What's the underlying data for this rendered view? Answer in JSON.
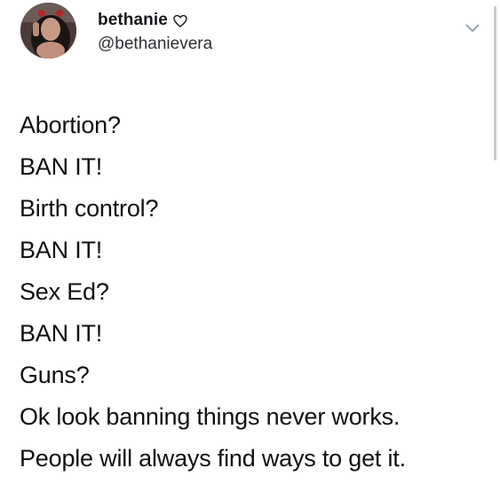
{
  "user": {
    "display_name": "bethanie",
    "handle": "@bethanievera",
    "badge_icon": "heart-outline-icon",
    "menu_icon": "chevron-down-icon"
  },
  "tweet": {
    "lines": [
      "Abortion?",
      "BAN IT!",
      "Birth control?",
      "BAN IT!",
      "Sex Ed?",
      "BAN IT!",
      "Guns?",
      "Ok look banning things never works.",
      "People will always find ways to get it."
    ]
  },
  "colors": {
    "text": "#14171a",
    "secondary_text": "#2c2f33",
    "chevron": "#8899a6",
    "background": "#ffffff"
  }
}
